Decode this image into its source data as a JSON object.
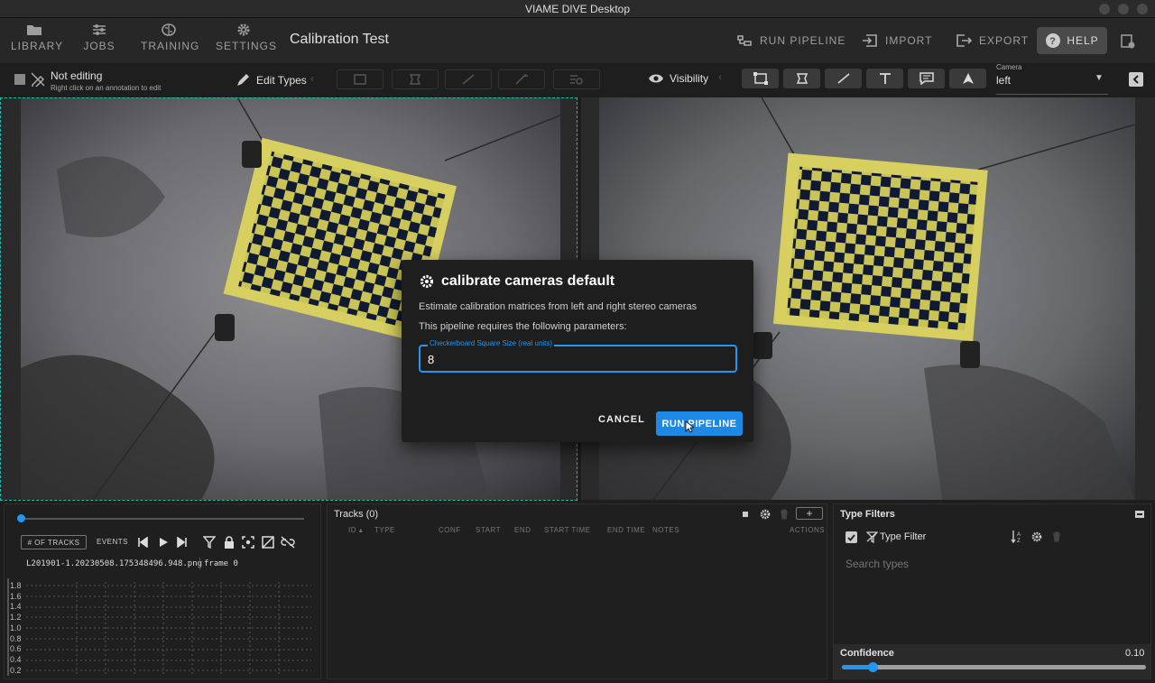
{
  "window": {
    "title": "VIAME DIVE Desktop"
  },
  "nav": {
    "library": "LIBRARY",
    "jobs": "JOBS",
    "training": "TRAINING",
    "settings": "SETTINGS"
  },
  "app_title": "Calibration Test",
  "actions": {
    "run_pipeline": "RUN PIPELINE",
    "import": "IMPORT",
    "export": "EXPORT",
    "help": "HELP"
  },
  "edit_status": {
    "title": "Not editing",
    "hint": "Right click on an annotation to edit"
  },
  "edit_types": "Edit Types",
  "visibility": "Visibility",
  "camera": {
    "label": "Camera",
    "value": "left"
  },
  "dialog": {
    "title": "calibrate cameras default",
    "description": "Estimate calibration matrices from left and right stereo cameras",
    "requirement": "This pipeline requires the following parameters:",
    "field_label": "Checkerboard Square Size (real units)",
    "field_value": "8",
    "cancel": "CANCEL",
    "run": "RUN PIPELINE"
  },
  "timeline": {
    "tracks_btn": "# OF TRACKS",
    "events_btn": "EVENTS",
    "filename": "L201901-1.20230508.175348496.948.png",
    "frame": "frame 0",
    "y_ticks": [
      "1.8",
      "1.6",
      "1.4",
      "1.2",
      "1.0",
      "0.8",
      "0.6",
      "0.4",
      "0.2"
    ]
  },
  "tracks": {
    "title": "Tracks (0)",
    "columns": [
      "ID",
      "TYPE",
      "CONF",
      "START",
      "END",
      "START TIME",
      "END TIME",
      "NOTES",
      "ACTIONS"
    ]
  },
  "type_filters": {
    "title": "Type Filters",
    "filter_label": "Type Filter",
    "search_placeholder": "Search types",
    "confidence_label": "Confidence",
    "confidence_value": "0.10",
    "confidence_level": 0.1
  }
}
